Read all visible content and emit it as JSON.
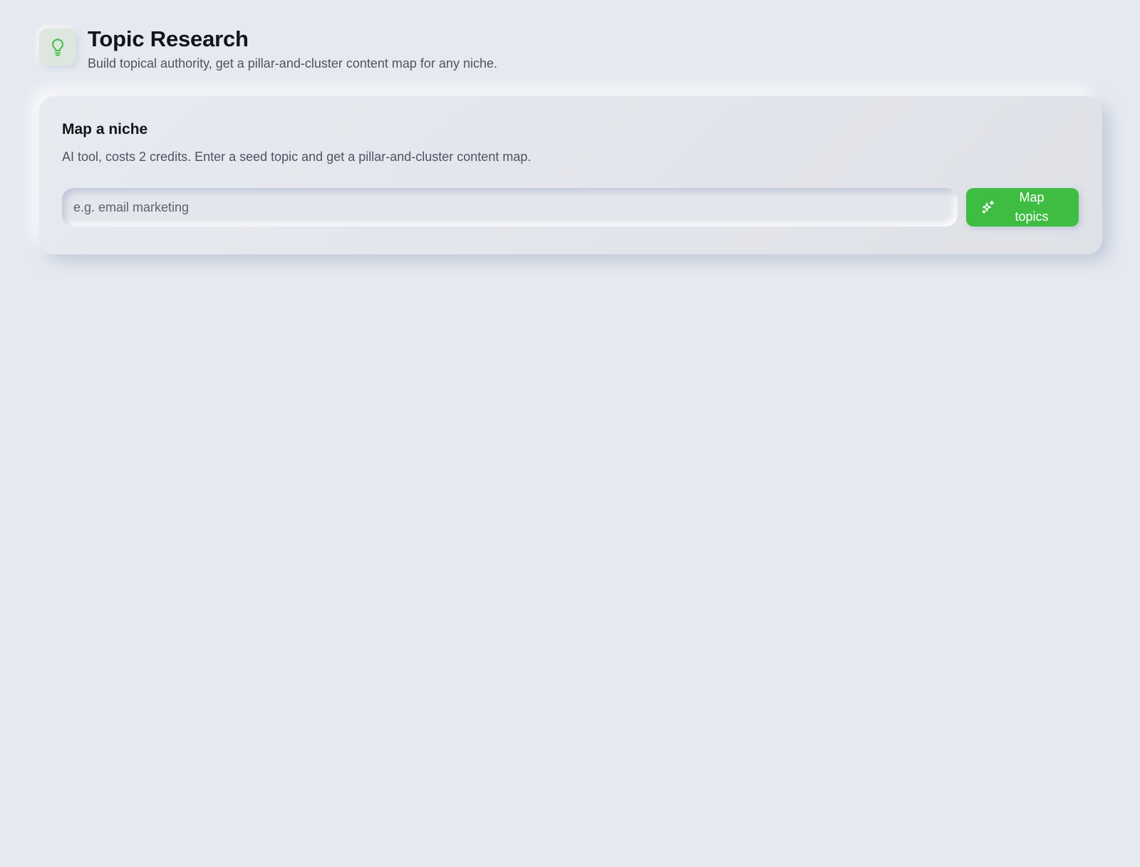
{
  "header": {
    "icon": "lightbulb-icon",
    "title": "Topic Research",
    "subtitle": "Build topical authority, get a pillar-and-cluster content map for any niche."
  },
  "card": {
    "title": "Map a niche",
    "description": "AI tool, costs 2 credits. Enter a seed topic and get a pillar-and-cluster content map.",
    "input": {
      "value": "",
      "placeholder": "e.g. email marketing"
    },
    "button": {
      "icon": "sparkles-icon",
      "label": "Map topics"
    }
  },
  "colors": {
    "background": "#e6e9f0",
    "accent_green": "#3fbd43",
    "icon_tile": "#dde7e0"
  }
}
